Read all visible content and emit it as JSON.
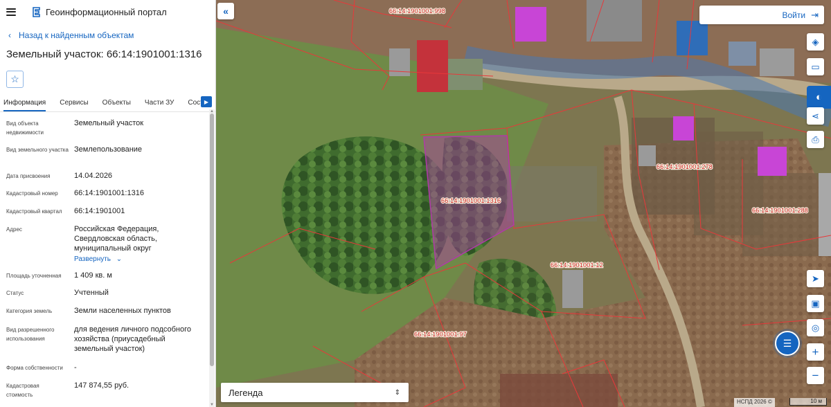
{
  "header": {
    "app_title": "Геоинформационный портал"
  },
  "nav": {
    "back_label": "Назад к найденным объектам"
  },
  "object": {
    "title": "Земельный участок: 66:14:1901001:1316"
  },
  "tabs": [
    {
      "label": "Информация"
    },
    {
      "label": "Сервисы"
    },
    {
      "label": "Объекты"
    },
    {
      "label": "Части ЗУ"
    },
    {
      "label": "Состав"
    }
  ],
  "fields": [
    {
      "label": "Вид объекта недвижимости",
      "value": "Земельный участок"
    },
    {
      "label": "Вид земельного участка",
      "value": "Землепользование"
    },
    {
      "label": "Дата присвоения",
      "value": "14.04.2026"
    },
    {
      "label": "Кадастровый номер",
      "value": "66:14:1901001:1316"
    },
    {
      "label": "Кадастровый квартал",
      "value": "66:14:1901001"
    },
    {
      "label": "Адрес",
      "value": "Российская Федерация, Свердловская область, муниципальный округ"
    },
    {
      "label": "Площадь уточненная",
      "value": "1 409 кв. м"
    },
    {
      "label": "Статус",
      "value": "Учтенный"
    },
    {
      "label": "Категория земель",
      "value": "Земли населенных пунктов"
    },
    {
      "label": "Вид разрешенного использования",
      "value": "для ведения личного подсобного хозяйства (приусадебный земельный участок)"
    },
    {
      "label": "Форма собственности",
      "value": "-"
    },
    {
      "label": "Кадастровая стоимость",
      "value": "147 874,55 руб."
    }
  ],
  "address_expand": "Развернуть",
  "map": {
    "login_label": "Войти",
    "legend_label": "Легенда",
    "attribution": "НСПД 2026 ©",
    "scale_label": "10 м",
    "parcel_labels": [
      "66:14:1901001:998",
      "66:14:1901001:1316",
      "66:14:1901001:278",
      "66:14:1901001:288",
      "66:14:1901001:12",
      "66:14:1901001:97"
    ]
  },
  "icons": {
    "menu": "hamburger-icon",
    "logo": "portal-logo-icon",
    "back": "chevron-left-icon",
    "favorite": "star-icon",
    "tabs_next": "chevron-right-icon",
    "collapse": "double-chevron-left-icon",
    "login": "login-icon",
    "layers": "layers-icon",
    "measure": "ruler-icon",
    "search_area": "map-search-icon",
    "share": "share-icon",
    "print": "print-icon",
    "locate": "navigation-arrow-icon",
    "minimap": "minimap-icon",
    "geo": "geolocation-icon",
    "chat": "chat-icon",
    "zoom_in": "plus-icon",
    "zoom_out": "minus-icon"
  },
  "colors": {
    "accent": "#1565c0",
    "parcel_border": "#e8383a",
    "selected_parcel": "#b03aa8",
    "building_highlight": "#c845d6"
  }
}
